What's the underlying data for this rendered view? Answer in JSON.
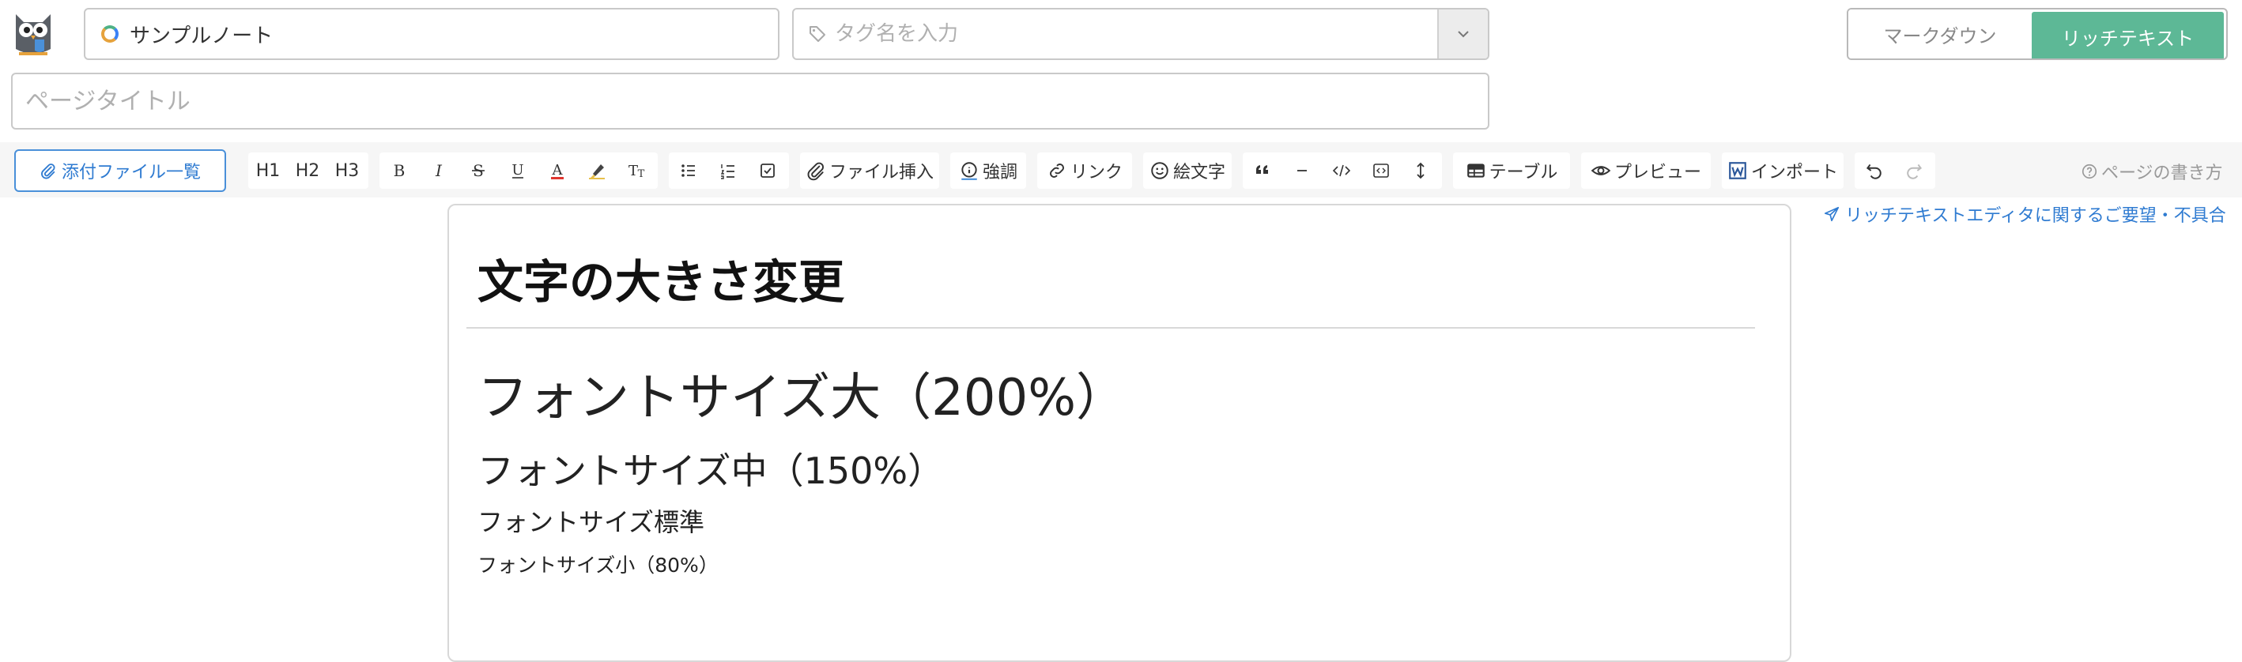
{
  "header": {
    "note_selector": {
      "label": "サンプルノート"
    },
    "tag_input": {
      "placeholder": "タグ名を入力",
      "value": ""
    },
    "mode_switch": {
      "markdown_label": "マークダウン",
      "rich_label": "リッチテキスト",
      "active": "rich"
    },
    "title_input": {
      "placeholder": "ページタイトル",
      "value": ""
    }
  },
  "toolbar": {
    "attach_label": "添付ファイル一覧",
    "h1": "H1",
    "h2": "H2",
    "h3": "H3",
    "insert_file": "ファイル挿入",
    "emphasis": "強調",
    "link": "リンク",
    "emoji": "絵文字",
    "table": "テーブル",
    "preview": "プレビュー",
    "import": "インポート",
    "help": "ページの書き方",
    "feedback": "リッチテキストエディタに関するご要望・不具合",
    "icons": [
      "paperclip-icon",
      "bold-icon",
      "italic-icon",
      "strikethrough-icon",
      "underline-icon",
      "font-color-icon",
      "highlight-icon",
      "clear-format-icon",
      "bullet-list-icon",
      "numbered-list-icon",
      "checklist-icon",
      "info-icon",
      "link-icon",
      "smile-icon",
      "quote-icon",
      "horizontal-rule-icon",
      "code-icon",
      "code-block-icon",
      "line-height-icon",
      "table-icon",
      "eye-icon",
      "word-icon",
      "undo-icon",
      "redo-icon",
      "help-icon",
      "send-icon"
    ],
    "colors": {
      "accent": "#5db896",
      "link": "#2f7bd1",
      "font_color_underline": "#e0362f",
      "highlight": "#e8c04a"
    }
  },
  "document": {
    "heading": "文字の大きさ変更",
    "lines": [
      {
        "text": "フォントサイズ大（200%）"
      },
      {
        "text": "フォントサイズ中（150%）"
      },
      {
        "text": "フォントサイズ標準"
      },
      {
        "text": "フォントサイズ小（80%）"
      }
    ]
  }
}
